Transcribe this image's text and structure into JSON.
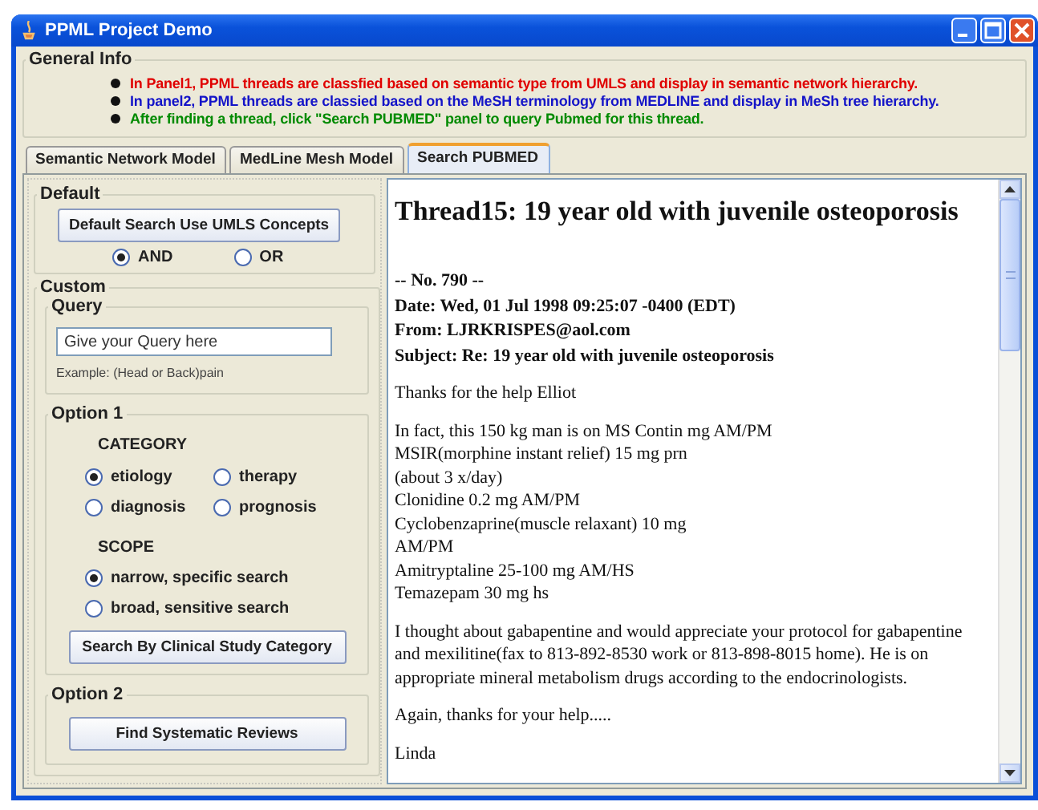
{
  "window": {
    "title": "PPML Project Demo"
  },
  "general_info": {
    "title": "General Info",
    "items": [
      {
        "text": "In Panel1, PPML threads are classfied based on semantic type from UMLS and display in semantic network hierarchy.",
        "color": "#e00000"
      },
      {
        "text": "In panel2, PPML threads are classied based on the MeSH terminology from MEDLINE and display in MeSh tree hierarchy.",
        "color": "#1414c8"
      },
      {
        "text": "After finding a thread, click \"Search PUBMED\" panel to query Pubmed for this thread.",
        "color": "#008a00"
      }
    ]
  },
  "tabs": [
    {
      "label": "Semantic Network Model",
      "selected": false
    },
    {
      "label": "MedLine Mesh Model",
      "selected": false
    },
    {
      "label": "Search PUBMED",
      "selected": true
    }
  ],
  "default": {
    "title": "Default",
    "button": "Default Search Use UMLS Concepts",
    "radios": [
      {
        "label": "AND",
        "selected": true
      },
      {
        "label": "OR",
        "selected": false
      }
    ]
  },
  "custom": {
    "title": "Custom",
    "query": {
      "title": "Query",
      "placeholder": "Give your Query here",
      "example": "Example: (Head or Back)pain"
    },
    "option1": {
      "title": "Option 1",
      "category": {
        "title": "CATEGORY",
        "radios": [
          {
            "label": "etiology",
            "selected": true
          },
          {
            "label": "therapy",
            "selected": false
          },
          {
            "label": "diagnosis",
            "selected": false
          },
          {
            "label": "prognosis",
            "selected": false
          }
        ]
      },
      "scope": {
        "title": "SCOPE",
        "radios": [
          {
            "label": "narrow, specific search",
            "selected": true
          },
          {
            "label": "broad, sensitive search",
            "selected": false
          }
        ]
      },
      "button": "Search By Clinical Study Category"
    },
    "option2": {
      "title": "Option 2",
      "button": "Find Systematic Reviews"
    }
  },
  "document": {
    "title": "Thread15: 19 year old with juvenile osteoporosis",
    "header": [
      "-- No. 790 --",
      "Date: Wed, 01 Jul 1998 09:25:07 -0400 (EDT)",
      "From: LJRKRISPES@aol.com",
      "Subject: Re: 19 year old with juvenile osteoporosis"
    ],
    "paragraphs": [
      [
        "Thanks for the help Elliot"
      ],
      [
        "In fact, this 150 kg man is on MS Contin mg AM/PM",
        "MSIR(morphine instant relief) 15 mg prn",
        "(about 3 x/day)",
        "Clonidine 0.2 mg AM/PM",
        "Cyclobenzaprine(muscle relaxant) 10 mg",
        "AM/PM",
        "Amitryptaline 25-100 mg AM/HS",
        "Temazepam 30 mg hs"
      ],
      [
        "I thought about gabapentine and would appreciate your protocol for gabapentine",
        "and mexilitine(fax to 813-892-8530 work or 813-898-8015 home). He is on",
        "appropriate mineral metabolism drugs according to the endocrinologists."
      ],
      [
        "Again, thanks for your help....."
      ],
      [
        "Linda"
      ]
    ]
  }
}
